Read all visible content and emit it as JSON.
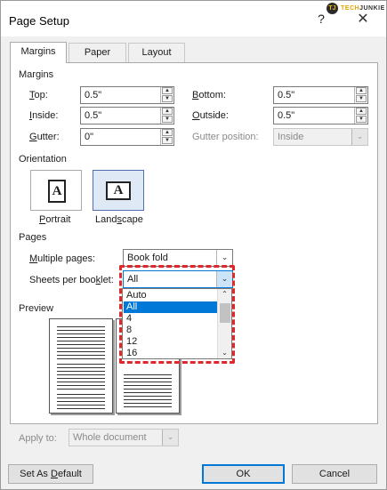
{
  "window": {
    "title": "Page Setup",
    "help_glyph": "?",
    "close_glyph": "✕"
  },
  "watermark": {
    "logo_letters": "TJ",
    "text_a": "TECH",
    "text_b": "JUNKIE"
  },
  "tabs": [
    {
      "label": "Margins",
      "active": true
    },
    {
      "label": "Paper",
      "active": false
    },
    {
      "label": "Layout",
      "active": false
    }
  ],
  "margins": {
    "group_label": "Margins",
    "top": {
      "label_key": "T",
      "label_rest": "op:",
      "value": "0.5\""
    },
    "inside": {
      "label_key": "I",
      "label_rest": "nside:",
      "value": "0.5\""
    },
    "gutter": {
      "label_key": "G",
      "label_rest": "utter:",
      "value": "0\""
    },
    "bottom": {
      "label_key": "B",
      "label_rest": "ottom:",
      "value": "0.5\""
    },
    "outside": {
      "label_key": "O",
      "label_rest": "utside:",
      "value": "0.5\""
    },
    "gutter_position": {
      "label": "Gutter position:",
      "value": "Inside",
      "disabled": true
    }
  },
  "orientation": {
    "group_label": "Orientation",
    "portrait": {
      "label_key": "P",
      "label_rest": "ortrait",
      "icon_letter": "A",
      "selected": false
    },
    "landscape": {
      "label_pre": "Land",
      "label_key": "s",
      "label_rest": "cape",
      "icon_letter": "A",
      "selected": true
    }
  },
  "pages": {
    "group_label": "Pages",
    "multiple_pages": {
      "label_key": "M",
      "label_rest": "ultiple pages:",
      "value": "Book fold"
    },
    "sheets_per_booklet": {
      "label_pre": "Sheets per boo",
      "label_key": "k",
      "label_rest": "let:",
      "value": "All",
      "options": [
        "Auto",
        "All",
        "4",
        "8",
        "12",
        "16"
      ],
      "selected_index": 1
    }
  },
  "preview": {
    "group_label": "Preview"
  },
  "apply_to": {
    "label": "Apply to:",
    "value": "Whole document",
    "disabled": true
  },
  "buttons": {
    "set_default_pre": "Set As ",
    "set_default_key": "D",
    "set_default_rest": "efault",
    "ok": "OK",
    "cancel": "Cancel"
  },
  "icons": {
    "chevron_down": "⌄",
    "spin_up": "▲",
    "spin_down": "▼",
    "scroll_up": "⌃",
    "scroll_down": "⌄"
  },
  "colors": {
    "highlight": "#e0282b",
    "selection": "#0078d7",
    "ok_border": "#0078d7"
  }
}
